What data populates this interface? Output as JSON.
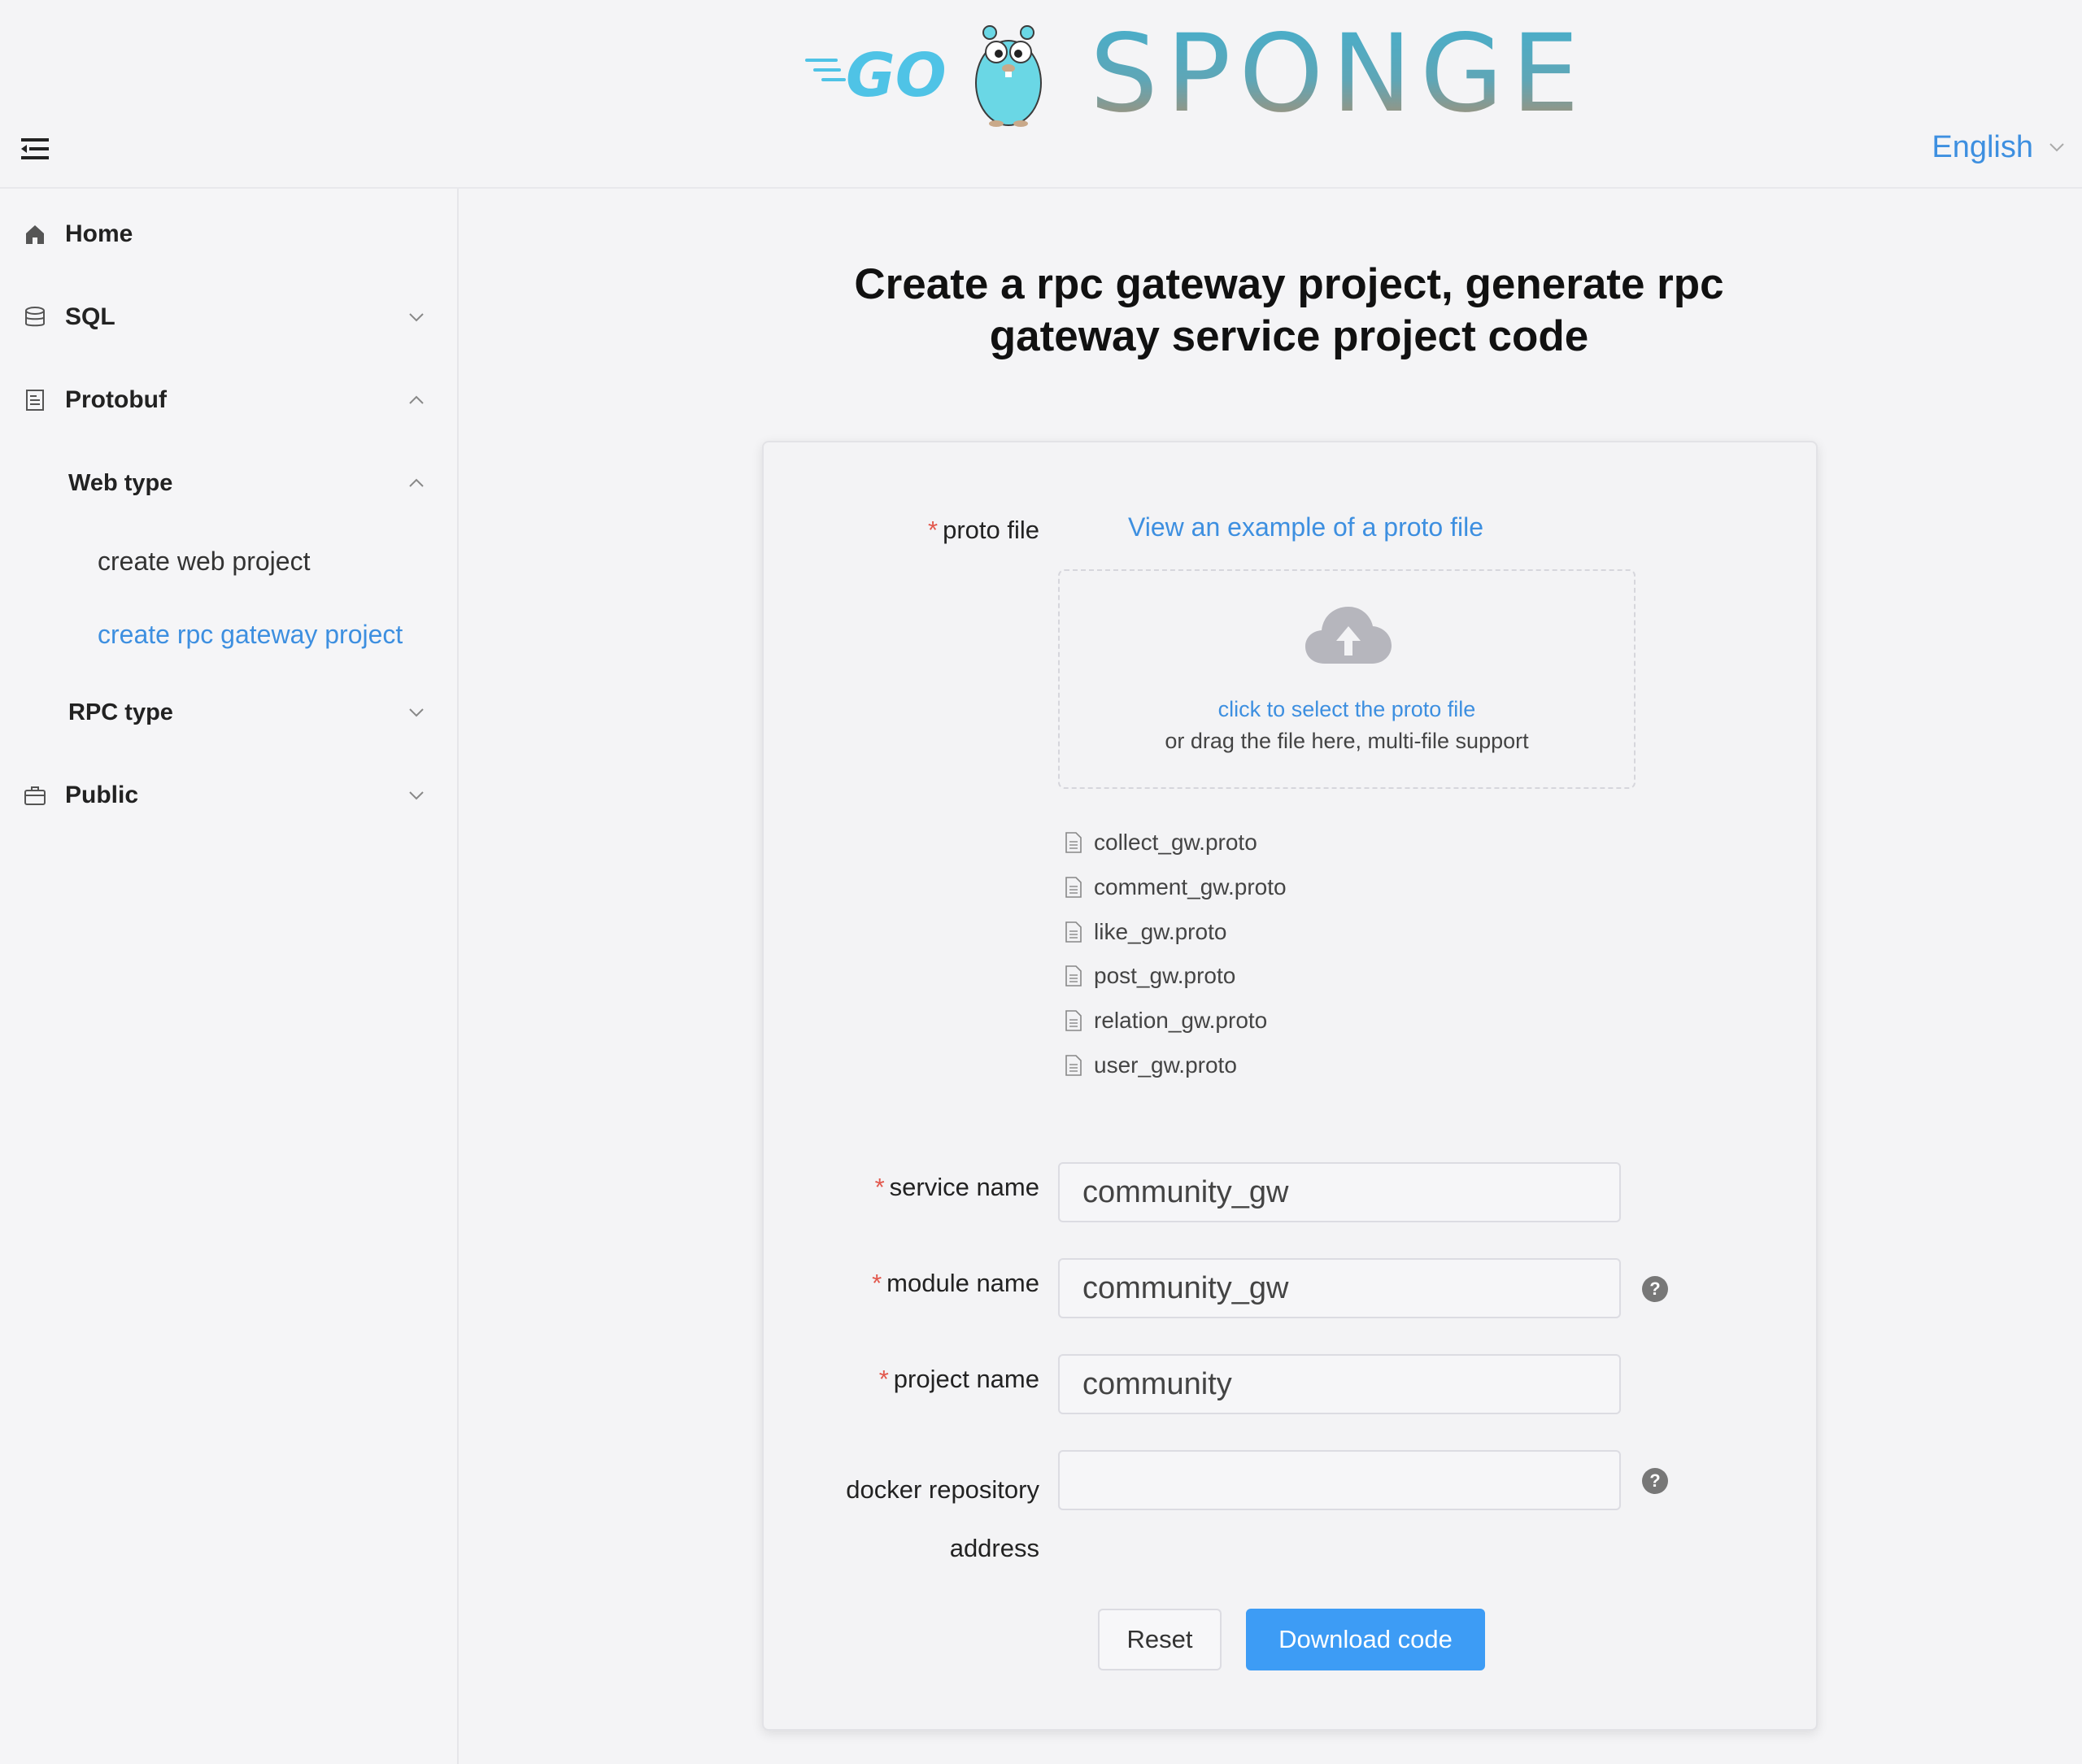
{
  "header": {
    "logo_go_text": "GO",
    "logo_sponge_text": "SPONGE",
    "language": "English",
    "icons": {
      "menu": "menu-fold-icon",
      "language_chevron": "chevron-down-icon"
    }
  },
  "sidebar": {
    "items": [
      {
        "label": "Home",
        "icon": "home-icon"
      },
      {
        "label": "SQL",
        "icon": "database-icon",
        "arrow": "chevron-down-icon"
      },
      {
        "label": "Protobuf",
        "icon": "document-icon",
        "arrow": "chevron-up-icon"
      },
      {
        "label": "Web type",
        "arrow": "chevron-up-icon"
      },
      {
        "label": "create web project"
      },
      {
        "label": "create rpc gateway project",
        "active": true
      },
      {
        "label": "RPC type",
        "arrow": "chevron-down-icon"
      },
      {
        "label": "Public",
        "icon": "briefcase-icon",
        "arrow": "chevron-down-icon"
      }
    ]
  },
  "main": {
    "title_line1": "Create a rpc gateway project, generate rpc",
    "title_line2": "gateway service project code"
  },
  "form": {
    "required_mark": "*",
    "proto_label": "proto file",
    "example_link": "View an example of a proto file",
    "upload": {
      "icon": "cloud-upload-icon",
      "link_text": "click to select the proto file",
      "hint_text": "or drag the file here, multi-file support"
    },
    "files": [
      "collect_gw.proto",
      "comment_gw.proto",
      "like_gw.proto",
      "post_gw.proto",
      "relation_gw.proto",
      "user_gw.proto"
    ],
    "service_name": {
      "label": "service name",
      "value": "community_gw"
    },
    "module_name": {
      "label": "module name",
      "value": "community_gw",
      "help": "?"
    },
    "project_name": {
      "label": "project name",
      "value": "community"
    },
    "docker_repo": {
      "label_line1": "docker repository",
      "label_line2": "address",
      "value": "",
      "help": "?"
    },
    "reset_label": "Reset",
    "download_label": "Download code"
  },
  "colors": {
    "accent": "#3d8fe0",
    "primary_button": "#3d9cf5",
    "required": "#e2574c",
    "background": "#f4f4f6"
  }
}
